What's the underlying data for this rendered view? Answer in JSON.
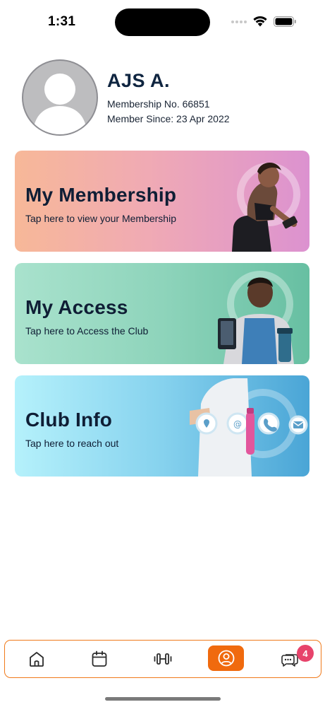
{
  "status_bar": {
    "time": "1:31"
  },
  "profile": {
    "name": "AJS A.",
    "membership_no": "Membership No. 66851",
    "member_since": "Member Since: 23 Apr 2022"
  },
  "cards": [
    {
      "title": "My Membership",
      "subtitle": "Tap here to view your Membership"
    },
    {
      "title": "My Access",
      "subtitle": "Tap here to Access the Club"
    },
    {
      "title": "Club Info",
      "subtitle": "Tap here to reach out"
    }
  ],
  "nav": {
    "items": [
      "home-icon",
      "calendar-icon",
      "dumbbell-icon",
      "profile-icon",
      "chat-icon"
    ],
    "active": "profile-icon",
    "chat_badge": "4"
  },
  "colors": {
    "accent": "#f06a0e",
    "badge": "#e7436b",
    "text": "#0f1e35"
  }
}
